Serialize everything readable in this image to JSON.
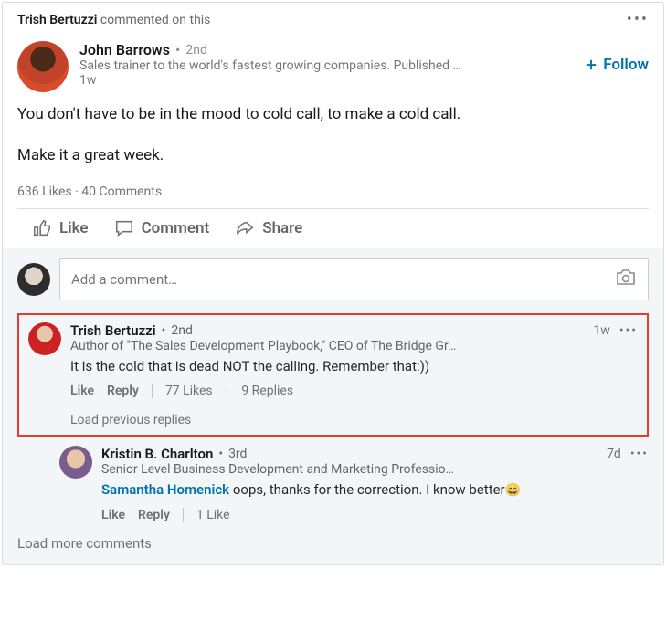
{
  "activity": {
    "actor": "Trish Bertuzzi",
    "action": "commented on this"
  },
  "post": {
    "author": {
      "name": "John Barrows",
      "degree": "2nd",
      "headline": "Sales trainer to the world's fastest growing companies. Published …",
      "time": "1w"
    },
    "follow_label": "Follow",
    "body_line1": "You don't have to be in the mood to cold call, to make a cold call.",
    "body_line2": "Make it a great week.",
    "likes_count": "636 Likes",
    "comments_count": "40 Comments"
  },
  "actions": {
    "like": "Like",
    "comment": "Comment",
    "share": "Share"
  },
  "comment_input": {
    "placeholder": "Add a comment…"
  },
  "highlighted_comment": {
    "author": "Trish Bertuzzi",
    "degree": "2nd",
    "time": "1w",
    "headline": "Author of \"The Sales Development Playbook,\" CEO of The Bridge Gr…",
    "text": "It is the cold that is dead NOT the calling. Remember that:))",
    "like": "Like",
    "reply": "Reply",
    "likes": "77 Likes",
    "replies": "9 Replies",
    "load_prev": "Load previous replies"
  },
  "reply1": {
    "author": "Kristin B. Charlton",
    "degree": "3rd",
    "time": "7d",
    "headline": "Senior Level Business Development and Marketing Professio…",
    "mention": "Samantha Homenick",
    "text": " oops, thanks for the correction.   I know better",
    "emoji": "😄",
    "like": "Like",
    "reply": "Reply",
    "likes": "1 Like"
  },
  "load_more": "Load more comments"
}
